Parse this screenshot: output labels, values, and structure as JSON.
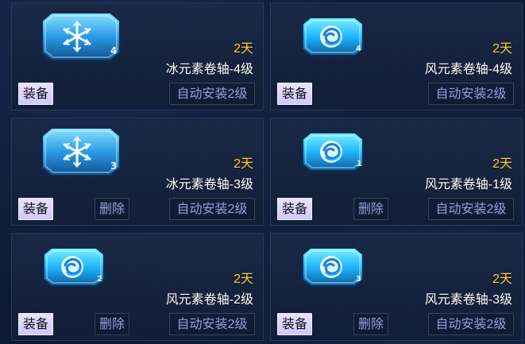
{
  "items": [
    {
      "element": "ice",
      "level_badge": "4",
      "days": "2天",
      "name": "冰元素卷轴-4级",
      "buttons": {
        "equip": "装备",
        "delete": "",
        "auto_install": "自动安装2级"
      }
    },
    {
      "element": "wind",
      "level_badge": "4",
      "days": "2天",
      "name": "风元素卷轴-4级",
      "buttons": {
        "equip": "装备",
        "delete": "",
        "auto_install": "自动安装2级"
      }
    },
    {
      "element": "ice",
      "level_badge": "3",
      "days": "2天",
      "name": "冰元素卷轴-3级",
      "buttons": {
        "equip": "装备",
        "delete": "删除",
        "auto_install": "自动安装2级"
      }
    },
    {
      "element": "wind",
      "level_badge": "1",
      "days": "2天",
      "name": "风元素卷轴-1级",
      "buttons": {
        "equip": "装备",
        "delete": "删除",
        "auto_install": "自动安装2级"
      }
    },
    {
      "element": "wind",
      "level_badge": "2",
      "days": "2天",
      "name": "风元素卷轴-2级",
      "buttons": {
        "equip": "装备",
        "delete": "删除",
        "auto_install": "自动安装2级"
      }
    },
    {
      "element": "wind",
      "level_badge": "3",
      "days": "2天",
      "name": "风元素卷轴-3级",
      "buttons": {
        "equip": "装备",
        "delete": "删除",
        "auto_install": "自动安装2级"
      }
    }
  ],
  "colors": {
    "accent_gold": "#ffcc33",
    "ice_blue": "#4fb3ff",
    "wind_blue": "#1fb6ff",
    "button_text": "#8fa0d8"
  }
}
